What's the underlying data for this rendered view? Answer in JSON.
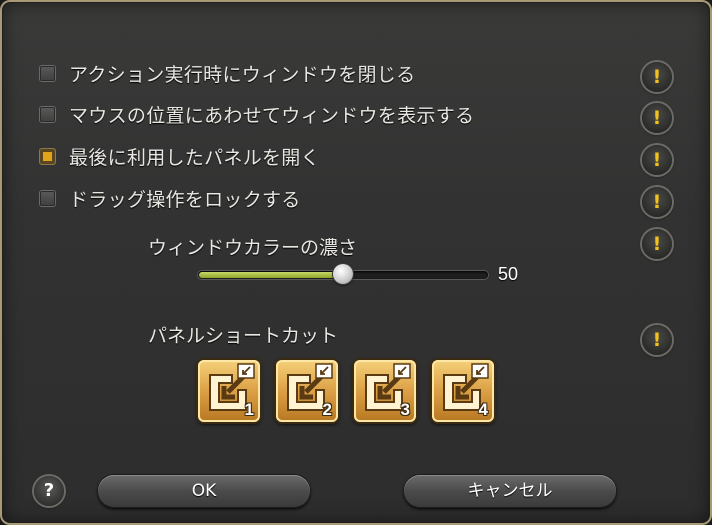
{
  "options": [
    {
      "label": "アクション実行時にウィンドウを閉じる",
      "checked": false
    },
    {
      "label": "マウスの位置にあわせてウィンドウを表示する",
      "checked": false
    },
    {
      "label": "最後に利用したパネルを開く",
      "checked": true
    },
    {
      "label": "ドラッグ操作をロックする",
      "checked": false
    }
  ],
  "info_icon_glyph": "!",
  "window_color": {
    "title": "ウィンドウカラーの濃さ",
    "value": "50",
    "fraction": 0.5
  },
  "panel_shortcut": {
    "title": "パネルショートカット",
    "buttons": [
      "1",
      "2",
      "3",
      "4"
    ]
  },
  "footer": {
    "help_glyph": "?",
    "ok_label": "OK",
    "cancel_label": "キャンセル"
  },
  "colors": {
    "accent_checked": "#e2a41a",
    "info_glyph": "#f3c21c",
    "slider_fill": "#a8bf3a",
    "panel_button": "#dca046"
  },
  "icons": {
    "info": "exclamation-icon",
    "help": "question-icon",
    "panel": "panel-shortcut-arrow-icon"
  }
}
